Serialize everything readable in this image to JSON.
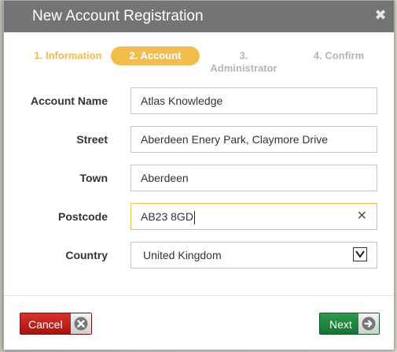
{
  "dialog": {
    "title": "New Account Registration",
    "close_glyph": "✖"
  },
  "steps": [
    {
      "label": "1. Information",
      "state": "done"
    },
    {
      "label": "2. Account",
      "state": "active"
    },
    {
      "label_line1": "3.",
      "label_line2": "Administrator",
      "state": "pending"
    },
    {
      "label": "4. Confirm",
      "state": "pending"
    }
  ],
  "form": {
    "account_name": {
      "label": "Account Name",
      "value": "Atlas Knowledge"
    },
    "street": {
      "label": "Street",
      "value": "Aberdeen Enery Park, Claymore Drive"
    },
    "town": {
      "label": "Town",
      "value": "Aberdeen"
    },
    "postcode": {
      "label": "Postcode",
      "value": "AB23 8GD",
      "clear_glyph": "✕"
    },
    "country": {
      "label": "Country",
      "value": "United Kingdom"
    }
  },
  "buttons": {
    "cancel": {
      "label": "Cancel",
      "icon": "cancel-x-icon"
    },
    "next": {
      "label": "Next",
      "icon": "arrow-right-icon"
    }
  },
  "colors": {
    "accent": "#f2bd4f",
    "titlebar": "#747474",
    "cancel": "#b51b17",
    "next": "#1f8540"
  }
}
